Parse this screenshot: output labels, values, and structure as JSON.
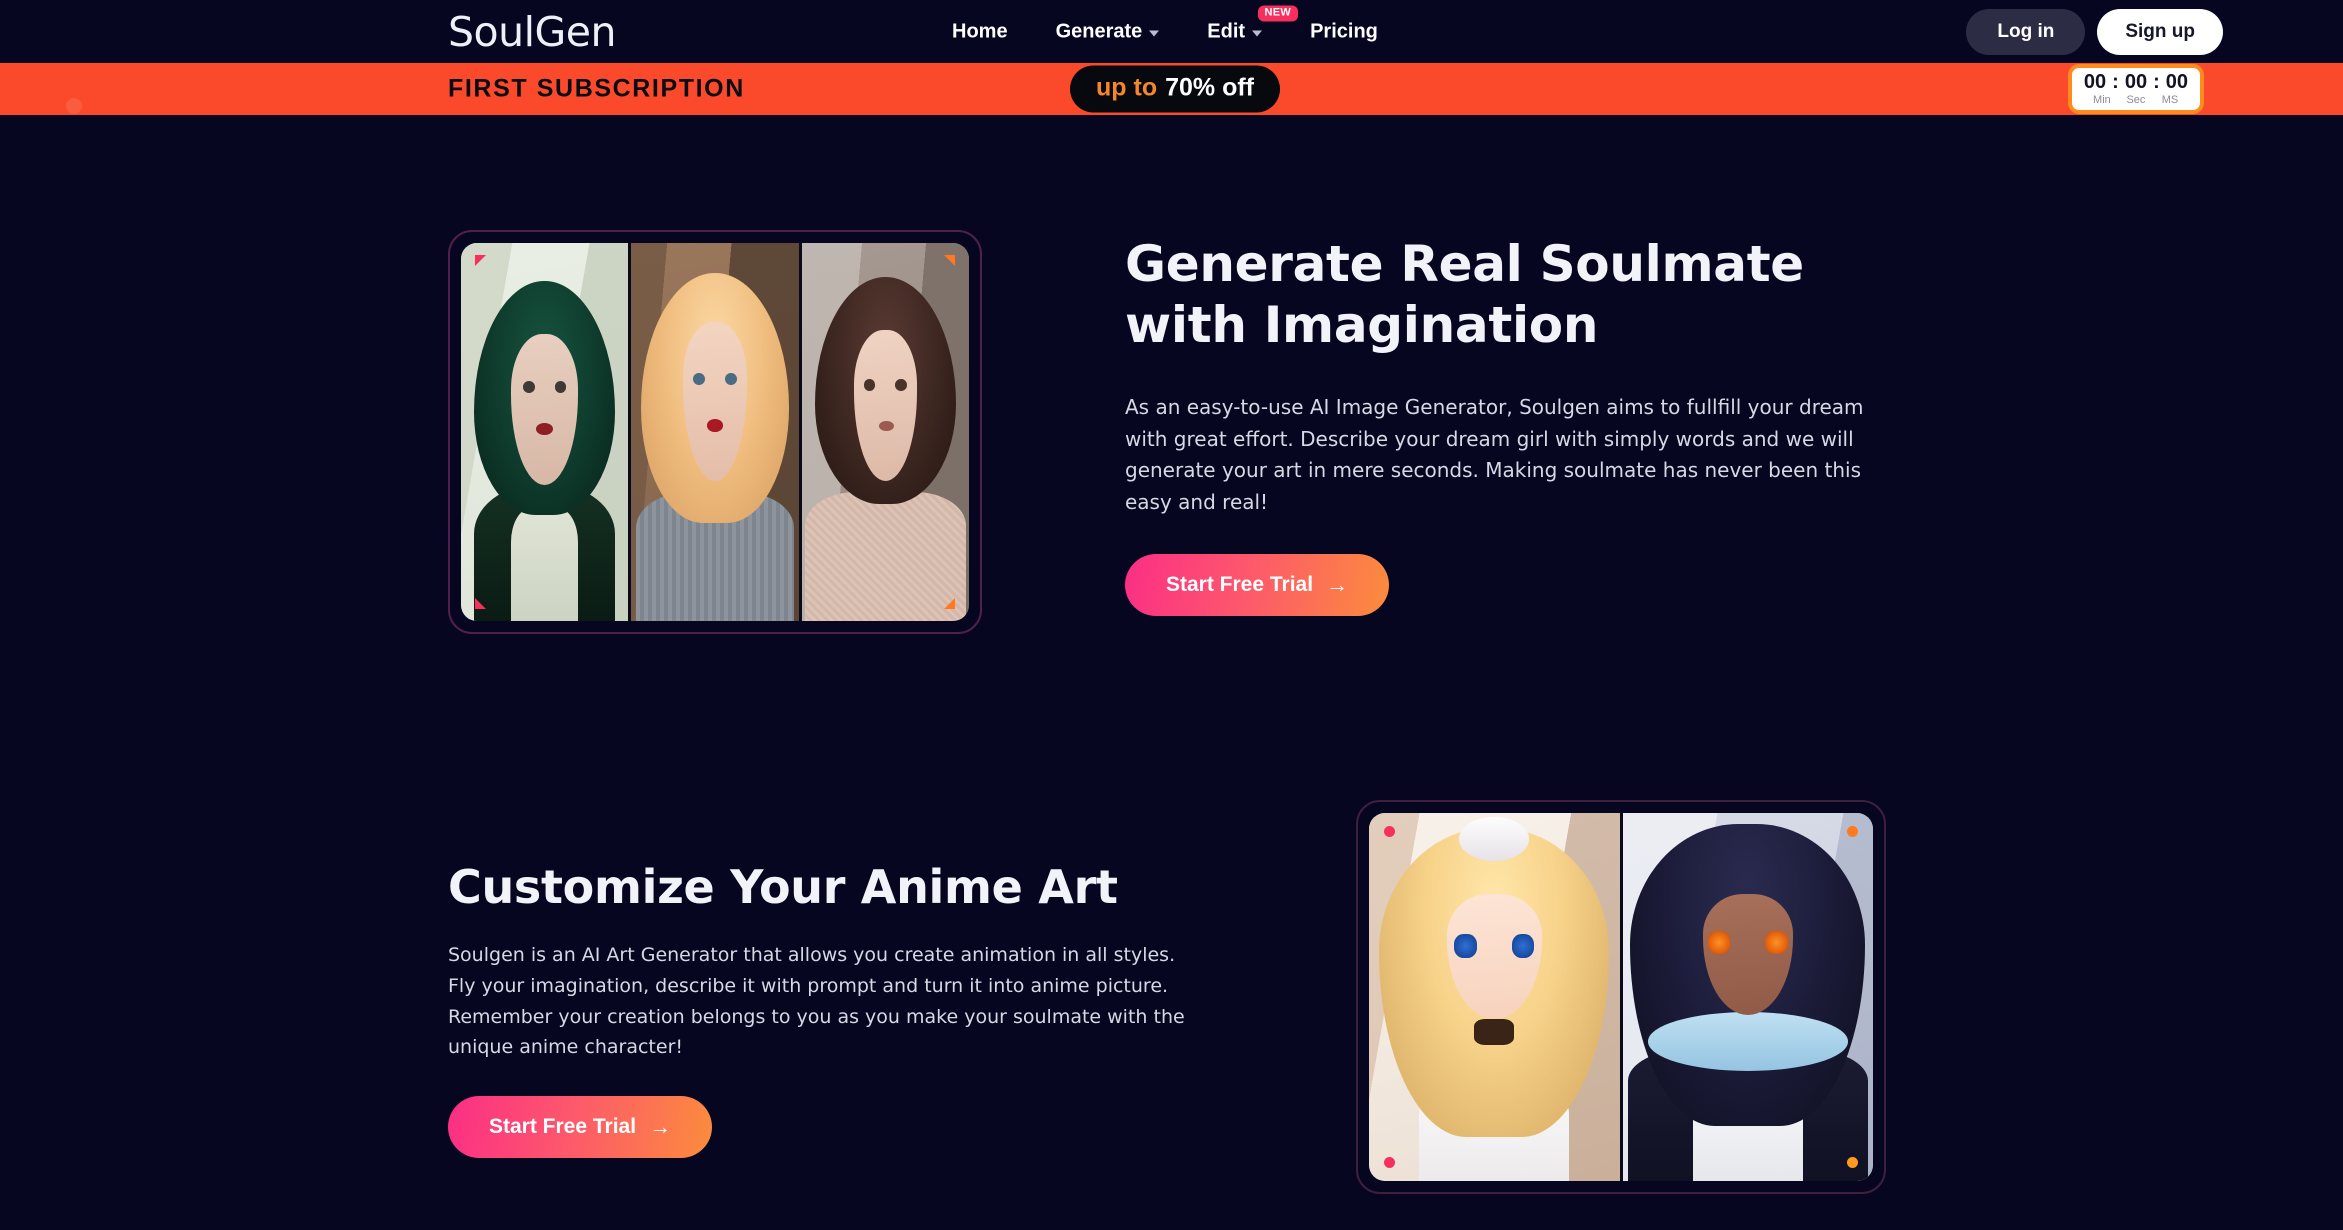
{
  "site": {
    "logo": "SoulGen"
  },
  "header": {
    "nav": [
      {
        "label": "Home",
        "has_caret": false,
        "badge": null
      },
      {
        "label": "Generate",
        "has_caret": true,
        "badge": null
      },
      {
        "label": "Edit",
        "has_caret": true,
        "badge": "NEW"
      },
      {
        "label": "Pricing",
        "has_caret": false,
        "badge": null
      }
    ],
    "login_label": "Log in",
    "signup_label": "Sign up"
  },
  "promo": {
    "title": "FIRST SUBSCRIPTION",
    "offer_prefix": "up to",
    "offer_amount": "70% off",
    "timer": {
      "minutes": "00",
      "seconds": "00",
      "milliseconds": "00",
      "separator": ":",
      "label_min": "Min",
      "label_sec": "Sec",
      "label_ms": "MS"
    }
  },
  "hero": {
    "heading": "Generate Real Soulmate with Imagination",
    "paragraph": "As an easy-to-use AI Image Generator, Soulgen aims to fullfill your dream with great effort. Describe your dream girl with simply words and we will generate your art in mere seconds. Making soulmate has never been this easy and real!",
    "cta_label": "Start Free Trial",
    "cta_arrow": "→"
  },
  "section2": {
    "heading": "Customize Your Anime Art",
    "paragraph": "Soulgen is an AI Art Generator that allows you create animation in all styles. Fly your imagination, describe it with prompt and turn it into anime picture.\nRemember your creation belongs to you as you make your soulmate with the unique anime character!",
    "cta_label": "Start Free Trial",
    "cta_arrow": "→"
  },
  "colors": {
    "background": "#060620",
    "promo_banner": "#fa4a2b",
    "accent_pink": "#f72f5f",
    "accent_orange": "#ff7a1e",
    "cta_gradient_start": "#fb2e86",
    "cta_gradient_end": "#fb8c3c",
    "timer_border": "#ff8a1e",
    "login_bg": "#2c2c44",
    "signup_bg": "#ffffff"
  }
}
